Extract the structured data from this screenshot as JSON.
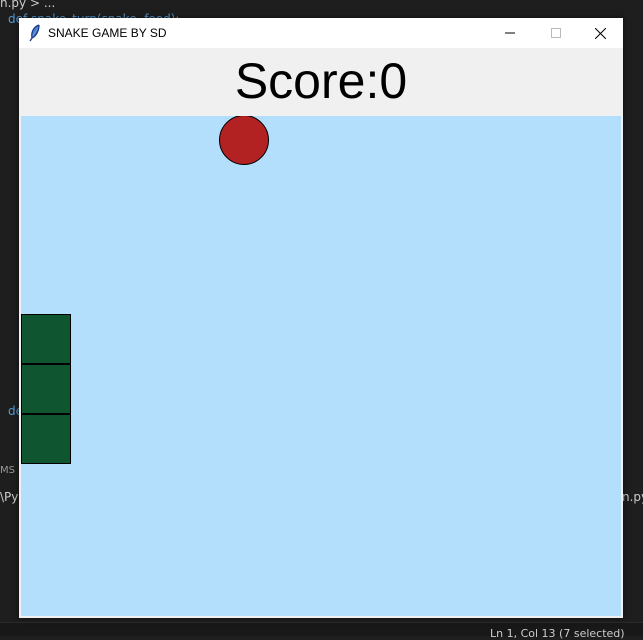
{
  "editor": {
    "breadcrumb": "n.py > ...",
    "code_fragment": "def snake_turn(snake, food):",
    "code_fragment2": "de",
    "panel_fragment": "MS",
    "terminal_left": "\\Py",
    "terminal_right": "n.py",
    "status": "Ln 1, Col 13 (7 selected)"
  },
  "window": {
    "title": "SNAKE GAME BY SD",
    "icon": "feather-icon",
    "controls": [
      "minimize",
      "maximize",
      "close"
    ]
  },
  "game": {
    "score_label": "Score:0",
    "score": 0,
    "colors": {
      "background": "#b3defc",
      "snake": "#0f5530",
      "food": "#b22222"
    }
  }
}
